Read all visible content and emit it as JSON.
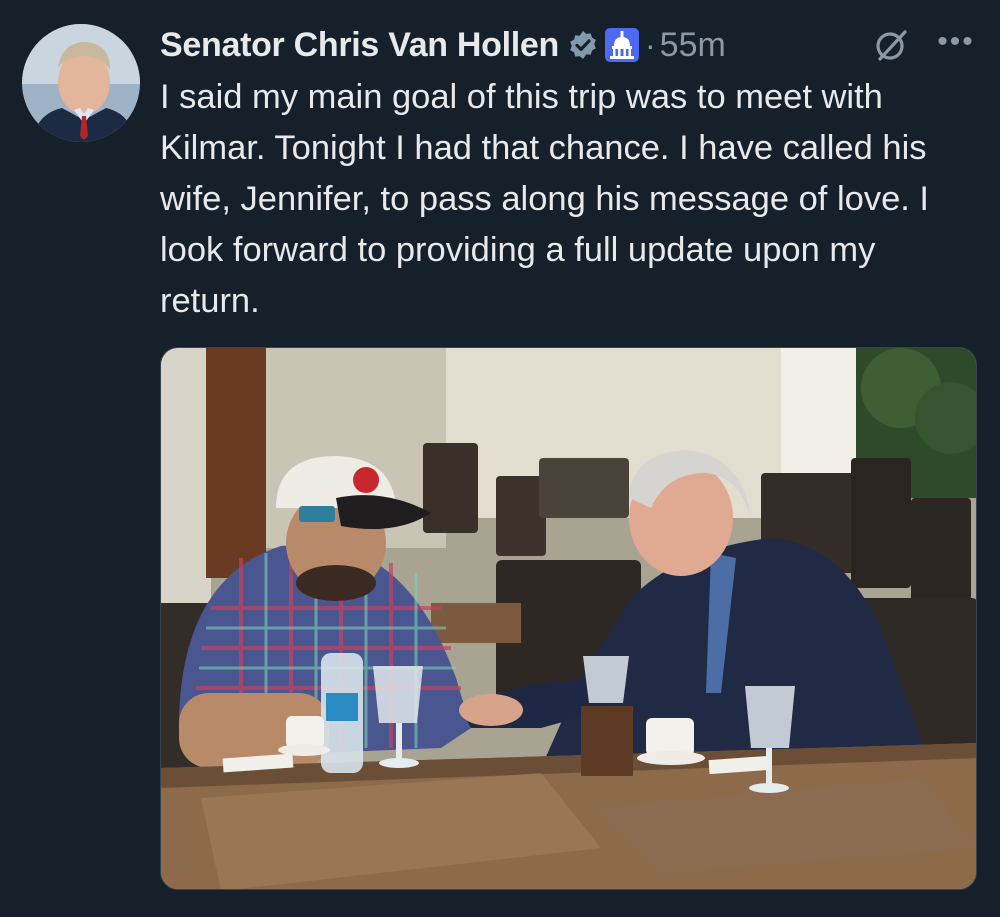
{
  "tweet": {
    "author_name": "Senator Chris Van Hollen",
    "verified_icon": "verified-badge-icon",
    "affiliation_icon": "capitol-affiliation-icon",
    "separator": "·",
    "timestamp": "55m",
    "grok_icon": "grok-icon",
    "more_icon": "more-options-icon",
    "more_glyph": "•••",
    "text": "I said my main goal of this trip was to meet with Kilmar. Tonight I had that chance. I have called his wife, Jennifer, to pass along his message of love. I look forward to providing a full update upon my return."
  },
  "colors": {
    "background": "#15202b",
    "text": "#e7e9ea",
    "secondary_text": "#8b98a5",
    "verified_badge": "#829aab",
    "affiliation_bg": "#4e6af2"
  }
}
